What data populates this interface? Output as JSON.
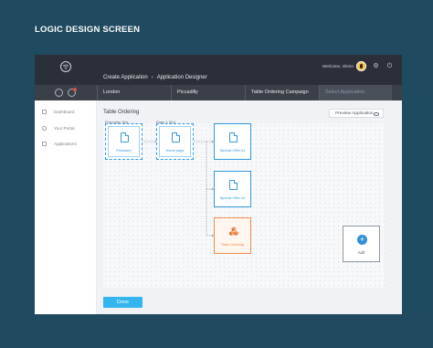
{
  "page_heading": "LOGIC DESIGN SCREEN",
  "topbar": {
    "breadcrumb": [
      "Create Application",
      "Application Designer"
    ],
    "welcome": "Welcome, Glenn"
  },
  "tabs": [
    {
      "label": "London"
    },
    {
      "label": "Piccadilly"
    },
    {
      "label": "Table Ordering Campaign"
    },
    {
      "label": "Select Application",
      "placeholder": true
    }
  ],
  "sidebar": {
    "items": [
      {
        "label": "Dashboard",
        "icon": "dashboard-icon"
      },
      {
        "label": "Your Portal",
        "icon": "portal-icon"
      },
      {
        "label": "Applications",
        "icon": "applications-icon"
      }
    ]
  },
  "content": {
    "title": "Table Ordering",
    "preview_button": "Preview Application"
  },
  "flow": {
    "slots": [
      "Preloader Slot",
      "Page 1 Slot"
    ],
    "nodes": [
      {
        "label": "Preloader",
        "icon": "document-icon"
      },
      {
        "label": "Home page",
        "icon": "document-icon"
      },
      {
        "label": "Special Offer #1",
        "icon": "document-icon"
      },
      {
        "label": "Special Offer #2",
        "icon": "document-icon"
      },
      {
        "label": "Table Ordering",
        "icon": "cubes-icon"
      }
    ],
    "add_label": "Add"
  },
  "done_button": "Done",
  "colors": {
    "background": "#1f4a5f",
    "topbar": "#2b2f38",
    "accent_blue": "#2f9ae0",
    "accent_orange": "#ef8b4b",
    "done_button": "#33b5f0"
  }
}
